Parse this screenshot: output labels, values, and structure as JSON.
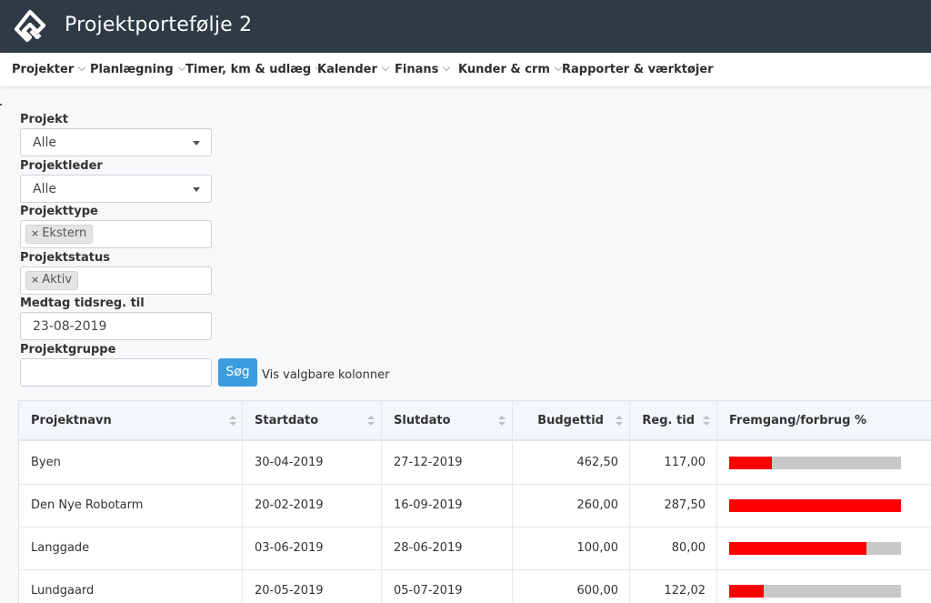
{
  "app": {
    "title": "Projektportefølje 2",
    "logo_icon": "app-logo-icon"
  },
  "nav": [
    {
      "label": "Projekter",
      "has_menu": true
    },
    {
      "label": "Planlægning",
      "has_menu": true
    },
    {
      "label": "Timer, km & udlæg",
      "has_menu": true
    },
    {
      "label": "Kalender",
      "has_menu": true
    },
    {
      "label": "Finans",
      "has_menu": true
    },
    {
      "label": "Kunder & crm",
      "has_menu": true
    },
    {
      "label": "Rapporter & værktøjer",
      "has_menu": false
    }
  ],
  "filters": {
    "project": {
      "label": "Projekt",
      "value": "Alle"
    },
    "manager": {
      "label": "Projektleder",
      "value": "Alle"
    },
    "type": {
      "label": "Projekttype",
      "tags": [
        "Ekstern"
      ]
    },
    "status": {
      "label": "Projektstatus",
      "tags": [
        "Aktiv"
      ]
    },
    "include_until": {
      "label": "Medtag tidsreg. til",
      "value": "23-08-2019"
    },
    "group": {
      "label": "Projektgruppe",
      "value": ""
    },
    "remove_symbol": "×"
  },
  "actions": {
    "search_label": "Søg",
    "columns_link": "Vis valgbare kolonner"
  },
  "table": {
    "columns": [
      "Projektnavn",
      "Startdato",
      "Slutdato",
      "Budgettid",
      "Reg. tid",
      "Fremgang/forbrug %"
    ],
    "rows": [
      {
        "name": "Byen",
        "start": "30-04-2019",
        "end": "27-12-2019",
        "budget": "462,50",
        "registered": "117,00",
        "progress": 0.25
      },
      {
        "name": "Den Nye Robotarm",
        "start": "20-02-2019",
        "end": "16-09-2019",
        "budget": "260,00",
        "registered": "287,50",
        "progress": 1.0
      },
      {
        "name": "Langgade",
        "start": "03-06-2019",
        "end": "28-06-2019",
        "budget": "100,00",
        "registered": "80,00",
        "progress": 0.8
      },
      {
        "name": "Lundgaard",
        "start": "20-05-2019",
        "end": "05-07-2019",
        "budget": "600,00",
        "registered": "122,02",
        "progress": 0.2
      }
    ]
  },
  "colors": {
    "topbar": "#2f3a45",
    "accent": "#3a9de0",
    "progress_fill": "#ff0000",
    "progress_track": "#c8c8c8"
  }
}
